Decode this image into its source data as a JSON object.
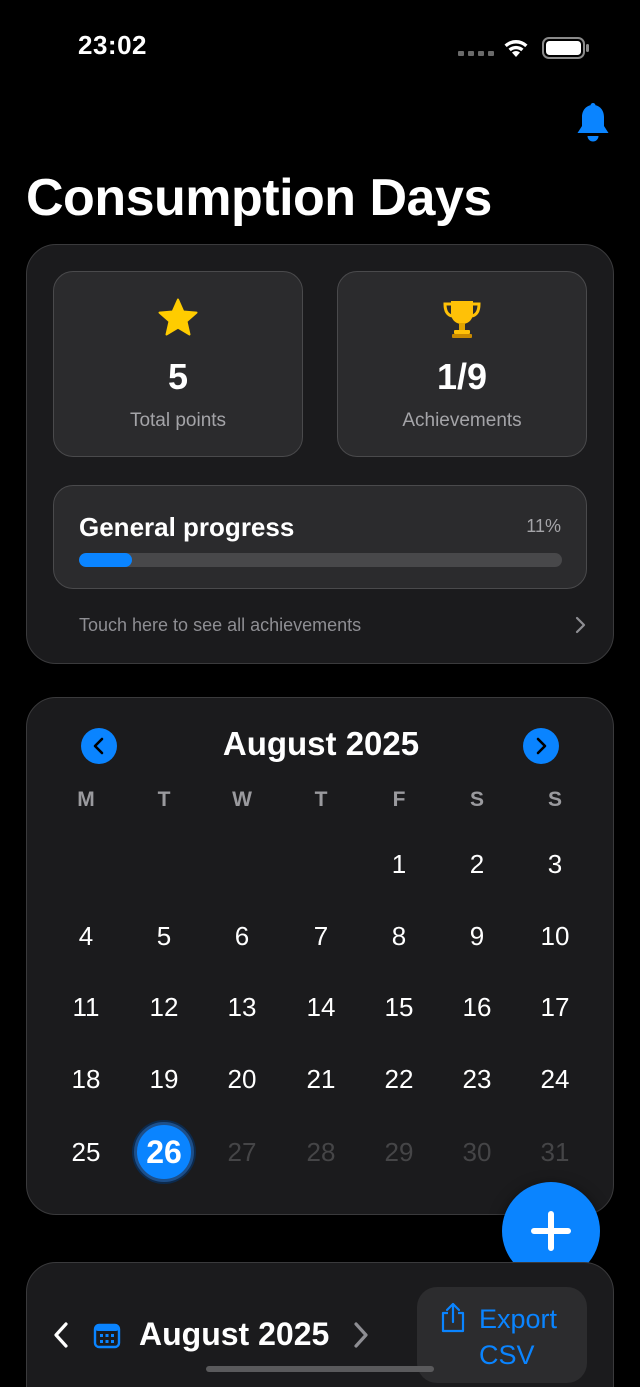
{
  "status_bar": {
    "time": "23:02"
  },
  "header": {
    "title": "Consumption Days",
    "notification_icon": "bell-icon"
  },
  "stats": {
    "points": {
      "icon": "star-icon",
      "value": "5",
      "label": "Total points"
    },
    "achievements": {
      "icon": "trophy-icon",
      "value": "1/9",
      "label": "Achievements"
    },
    "progress": {
      "title": "General progress",
      "percent_label": "11%",
      "fraction": 0.11
    },
    "link_text": "Touch here to see all achievements"
  },
  "calendar": {
    "month_label": "August 2025",
    "weekdays": [
      "M",
      "T",
      "W",
      "T",
      "F",
      "S",
      "S"
    ],
    "days": [
      "1",
      "2",
      "3",
      "4",
      "5",
      "6",
      "7",
      "8",
      "9",
      "10",
      "11",
      "12",
      "13",
      "14",
      "15",
      "16",
      "17",
      "18",
      "19",
      "20",
      "21",
      "22",
      "23",
      "24",
      "25",
      "26",
      "27",
      "28",
      "29",
      "30",
      "31"
    ],
    "first_weekday_index": 4,
    "today": "26"
  },
  "bottom": {
    "month_label": "August 2025",
    "export_label": "Export CSV"
  },
  "colors": {
    "accent": "#0a84ff",
    "star": "#ffcc00",
    "trophy": "#ffc107",
    "background": "#000000",
    "card": "#1b1b1d"
  }
}
